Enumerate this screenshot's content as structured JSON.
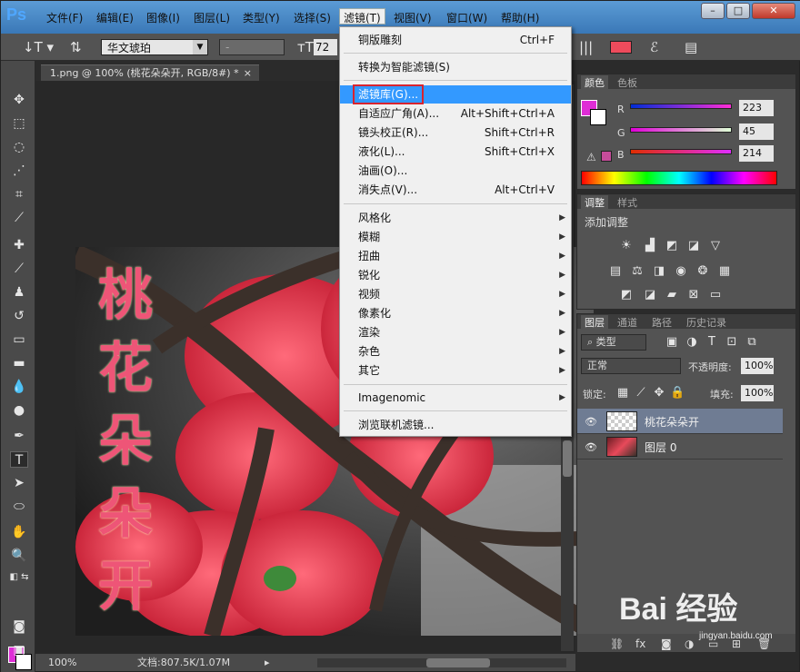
{
  "app": {
    "logo": "Ps"
  },
  "menu": [
    {
      "label": "文件(F)"
    },
    {
      "label": "编辑(E)"
    },
    {
      "label": "图像(I)"
    },
    {
      "label": "图层(L)"
    },
    {
      "label": "类型(Y)"
    },
    {
      "label": "选择(S)"
    },
    {
      "label": "滤镜(T)"
    },
    {
      "label": "视图(V)"
    },
    {
      "label": "窗口(W)"
    },
    {
      "label": "帮助(H)"
    }
  ],
  "window_buttons": {
    "minimize": "–",
    "maximize": "□",
    "close": "✕"
  },
  "options": {
    "font_family": "华文琥珀",
    "font_style": "-",
    "font_size": "72"
  },
  "document": {
    "tab_title": "1.png @ 100% (桃花朵朵开, RGB/8#) *",
    "close": "×",
    "text_layer_content": "桃花朵朵开"
  },
  "status": {
    "zoom": "100%",
    "doc_info": "文档:807.5K/1.07M"
  },
  "filter_menu": {
    "items": [
      {
        "label": "铜版雕刻",
        "shortcut": "Ctrl+F"
      },
      {
        "label": "转换为智能滤镜(S)",
        "shortcut": ""
      },
      {
        "label": "滤镜库(G)...",
        "shortcut": ""
      },
      {
        "label": "自适应广角(A)...",
        "shortcut": "Alt+Shift+Ctrl+A"
      },
      {
        "label": "镜头校正(R)...",
        "shortcut": "Shift+Ctrl+R"
      },
      {
        "label": "液化(L)...",
        "shortcut": "Shift+Ctrl+X"
      },
      {
        "label": "油画(O)...",
        "shortcut": ""
      },
      {
        "label": "消失点(V)...",
        "shortcut": "Alt+Ctrl+V"
      },
      {
        "label": "风格化",
        "shortcut": ""
      },
      {
        "label": "模糊",
        "shortcut": ""
      },
      {
        "label": "扭曲",
        "shortcut": ""
      },
      {
        "label": "锐化",
        "shortcut": ""
      },
      {
        "label": "视频",
        "shortcut": ""
      },
      {
        "label": "像素化",
        "shortcut": ""
      },
      {
        "label": "渲染",
        "shortcut": ""
      },
      {
        "label": "杂色",
        "shortcut": ""
      },
      {
        "label": "其它",
        "shortcut": ""
      },
      {
        "label": "Imagenomic",
        "shortcut": ""
      },
      {
        "label": "浏览联机滤镜...",
        "shortcut": ""
      }
    ]
  },
  "color_panel": {
    "tabs": [
      "颜色",
      "色板"
    ],
    "r_label": "R",
    "g_label": "G",
    "b_label": "B",
    "r": "223",
    "g": "45",
    "b": "214",
    "foreground_color": "#df2dd6"
  },
  "adjust_panel": {
    "tabs": [
      "调整",
      "样式"
    ],
    "title": "添加调整"
  },
  "layers_panel": {
    "tabs": [
      "图层",
      "通道",
      "路径",
      "历史记录"
    ],
    "filter_kind": "类型",
    "blend_mode": "正常",
    "opacity_label": "不透明度:",
    "opacity": "100%",
    "lock_label": "锁定:",
    "fill_label": "填充:",
    "fill": "100%",
    "layers": [
      {
        "name": "桃花朵朵开"
      },
      {
        "name": "图层 0"
      }
    ]
  },
  "watermark": {
    "brand": "Bai 经验",
    "url": "jingyan.baidu.com"
  }
}
